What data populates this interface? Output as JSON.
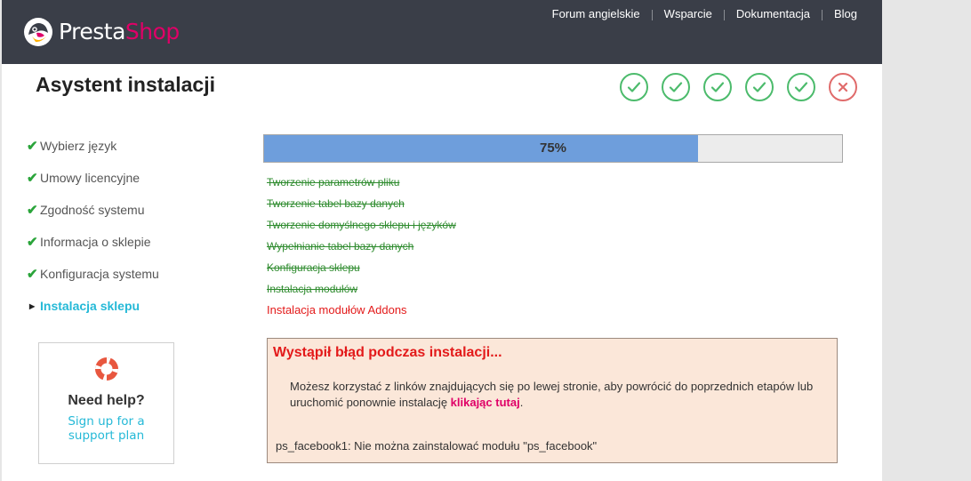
{
  "brand": {
    "presta": "Presta",
    "shop": "Shop",
    "accent": "#df0067"
  },
  "topnav": [
    "Forum angielskie",
    "Wsparcie",
    "Dokumentacja",
    "Blog"
  ],
  "page_title": "Asystent instalacji",
  "step_status": [
    "done",
    "done",
    "done",
    "done",
    "done",
    "error"
  ],
  "sidebar": {
    "items": [
      {
        "label": "Wybierz język",
        "state": "done"
      },
      {
        "label": "Umowy licencyjne",
        "state": "done"
      },
      {
        "label": "Zgodność systemu",
        "state": "done"
      },
      {
        "label": "Informacja o sklepie",
        "state": "done"
      },
      {
        "label": "Konfiguracja systemu",
        "state": "done"
      },
      {
        "label": "Instalacja sklepu",
        "state": "active"
      }
    ]
  },
  "help": {
    "title": "Need help?",
    "link": "Sign up for a support plan"
  },
  "progress": {
    "value": 75,
    "label": "75%"
  },
  "tasks": [
    {
      "label": "Tworzenie parametrów pliku",
      "state": "done"
    },
    {
      "label": "Tworzenie tabel bazy danych",
      "state": "done"
    },
    {
      "label": "Tworzenie domyślnego sklepu i języków",
      "state": "done"
    },
    {
      "label": "Wypełnianie tabel bazy danych",
      "state": "done"
    },
    {
      "label": "Konfiguracja sklepu",
      "state": "done"
    },
    {
      "label": "Instalacja modułów",
      "state": "done"
    },
    {
      "label": "Instalacja modułów Addons",
      "state": "error"
    }
  ],
  "error": {
    "title": "Wystąpił błąd podczas instalacji...",
    "message_before": "Możesz korzystać z linków znajdujących się po lewej stronie, aby powrócić do poprzednich etapów lub uruchomić ponownie instalację ",
    "link": "klikając tutaj",
    "message_after": ".",
    "detail": "ps_facebook1: Nie można zainstalować modułu \"ps_facebook\""
  },
  "colors": {
    "header_bg": "#3a3e48",
    "success": "#4cbb6c",
    "error": "#e06b6b",
    "progress_fill": "#6e9edc",
    "sidebar_active": "#25b9d7",
    "error_box_bg": "#fbe7d9"
  }
}
